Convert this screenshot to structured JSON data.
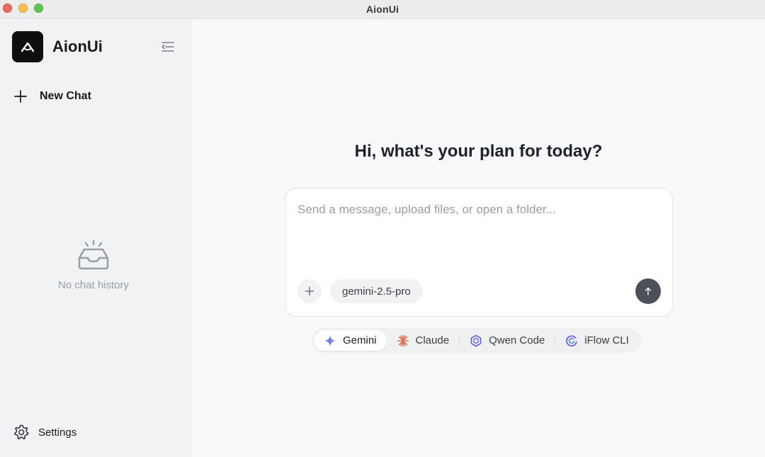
{
  "window": {
    "title": "AionUi"
  },
  "sidebar": {
    "brand": "AionUi",
    "new_chat_label": "New Chat",
    "empty_history": "No chat history",
    "settings_label": "Settings"
  },
  "main": {
    "greeting": "Hi, what's your plan for today?",
    "composer": {
      "placeholder": "Send a message, upload files, or open a folder...",
      "value": "",
      "model": "gemini-2.5-pro"
    },
    "agents": [
      {
        "label": "Gemini",
        "icon": "gemini-icon",
        "active": true
      },
      {
        "label": "Claude",
        "icon": "claude-icon",
        "active": false
      },
      {
        "label": "Qwen Code",
        "icon": "qwen-icon",
        "active": false
      },
      {
        "label": "iFlow CLI",
        "icon": "iflow-icon",
        "active": false
      }
    ]
  },
  "colors": {
    "sidebar_bg": "#f1f2f4",
    "main_bg": "#f8f9fa",
    "send_button": "#4b5059",
    "claude_accent": "#d97757",
    "qwen_accent": "#6b5ce7",
    "iflow_accent": "#7b5cf0"
  }
}
